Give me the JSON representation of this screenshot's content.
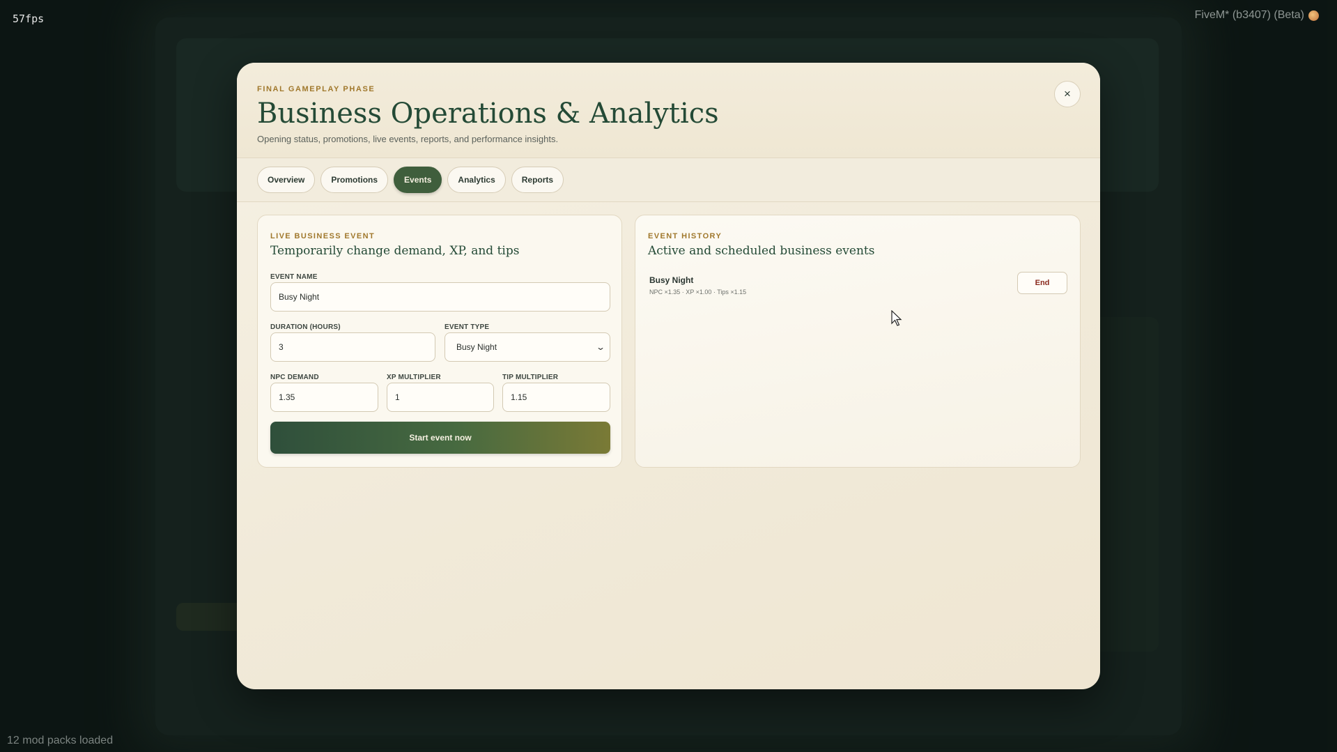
{
  "overlay": {
    "fps": "57fps",
    "client_label": "FiveM* (b3407) (Beta)",
    "mod_packs": "12 mod packs loaded"
  },
  "modal": {
    "phase_label": "FINAL GAMEPLAY PHASE",
    "title": "Business Operations & Analytics",
    "subtitle": "Opening status, promotions, live events, reports, and performance insights.",
    "close_symbol": "×",
    "tabs": [
      {
        "label": "Overview",
        "active": false
      },
      {
        "label": "Promotions",
        "active": false
      },
      {
        "label": "Events",
        "active": true
      },
      {
        "label": "Analytics",
        "active": false
      },
      {
        "label": "Reports",
        "active": false
      }
    ]
  },
  "live_event": {
    "eyebrow": "LIVE BUSINESS EVENT",
    "title": "Temporarily change demand, XP, and tips",
    "event_name_label": "EVENT NAME",
    "event_name_value": "Busy Night",
    "duration_label": "DURATION (HOURS)",
    "duration_value": "3",
    "event_type_label": "EVENT TYPE",
    "event_type_value": "Busy Night",
    "npc_demand_label": "NPC DEMAND",
    "npc_demand_value": "1.35",
    "xp_multiplier_label": "XP MULTIPLIER",
    "xp_multiplier_value": "1",
    "tip_multiplier_label": "TIP MULTIPLIER",
    "tip_multiplier_value": "1.15",
    "start_button": "Start event now"
  },
  "event_history": {
    "eyebrow": "EVENT HISTORY",
    "title": "Active and scheduled business events",
    "events": [
      {
        "name": "Busy Night",
        "meta": "NPC ×1.35 · XP ×1.00 · Tips ×1.15",
        "action": "End"
      }
    ]
  },
  "colors": {
    "accent_green": "#3f5e3c",
    "title_green": "#244a36",
    "eyebrow_gold": "#a0782c",
    "end_red": "#8a2a1e"
  }
}
